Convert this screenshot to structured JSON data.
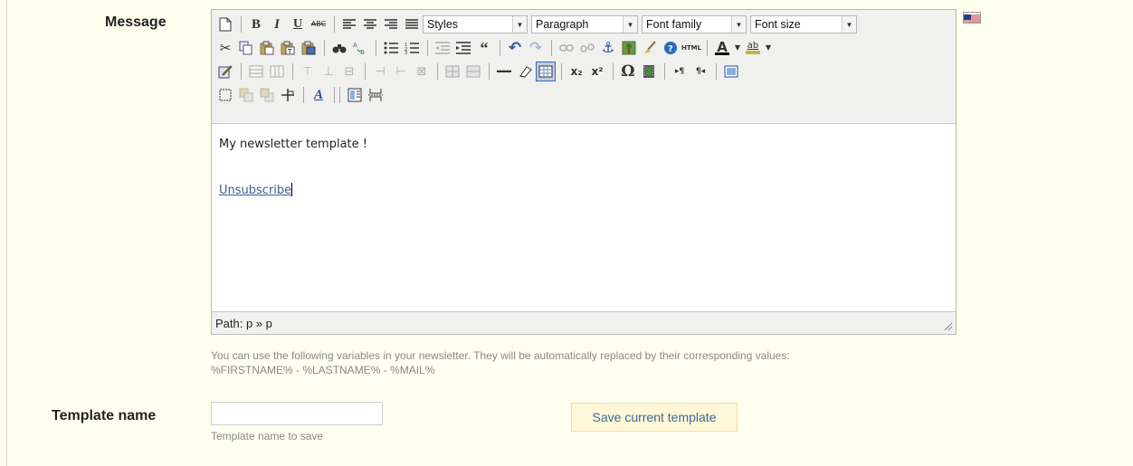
{
  "message": {
    "label": "Message"
  },
  "editor": {
    "toolbar": {
      "styles_label": "Styles",
      "format_label": "Paragraph",
      "font_family_label": "Font family",
      "font_size_label": "Font size",
      "buttons": {
        "new_document": "🗋",
        "bold": "B",
        "italic": "I",
        "underline": "U",
        "strikethrough": "ABC",
        "align_left": "☰",
        "align_center": "☰",
        "align_right": "☰",
        "align_justify": "☰",
        "cut": "✂",
        "copy": "⎘",
        "paste": "📋",
        "paste_text": "📋",
        "paste_word": "📋",
        "find": "🔍",
        "replace": "⇄",
        "bullet_list": "☰",
        "number_list": "☰",
        "outdent": "⇤",
        "indent": "⇥",
        "blockquote": "“",
        "undo": "↶",
        "redo": "↷",
        "link": "⛓",
        "unlink": "⛓",
        "anchor": "⚓",
        "image": "🖼",
        "cleanup": "🧹",
        "help": "?",
        "html": "HTML",
        "text_color": "A",
        "background_color": "ab",
        "edit_source": "✎",
        "table_props": "▦",
        "cell_props": "▦",
        "row_before": "⊤",
        "row_after": "⊥",
        "delete_row": "⊟",
        "col_before": "⊣",
        "col_after": "⊢",
        "delete_col": "⊠",
        "split_cells": "▦",
        "merge_cells": "▦",
        "horizontal_rule": "—",
        "remove_format": "⌫",
        "visual_aid": "▦",
        "subscript": "x₂",
        "superscript": "x²",
        "special_char": "Ω",
        "media": "🎞",
        "ltr": "▸¶",
        "rtl": "¶◂",
        "fullscreen": "⛶",
        "insert_layer": "⬚",
        "move_forward": "⧉",
        "move_backward": "⧉",
        "absolute": "⊹",
        "styles_props": "A",
        "template": "▤",
        "page_break": "⤓"
      }
    },
    "content": {
      "line1": "My newsletter template !",
      "link_text": "Unsubscribe"
    },
    "statusbar": {
      "path": "Path: p » p"
    },
    "language_flag_icon": "us-flag-icon"
  },
  "hint": {
    "line1": "You can use the following variables in your newsletter. They will be automatically replaced by their corresponding values:",
    "line2": "%FIRSTNAME% - %LASTNAME% - %MAIL%"
  },
  "template_name": {
    "label": "Template name",
    "value": "",
    "placeholder": "",
    "hint": "Template name to save",
    "save_button": "Save current template"
  },
  "colors": {
    "page_bg": "#fffff0",
    "link": "#3a5f8f",
    "save_button_bg": "#fff7d8",
    "save_button_text": "#3b6a93",
    "toolbar_bg": "#f0f0ee"
  }
}
